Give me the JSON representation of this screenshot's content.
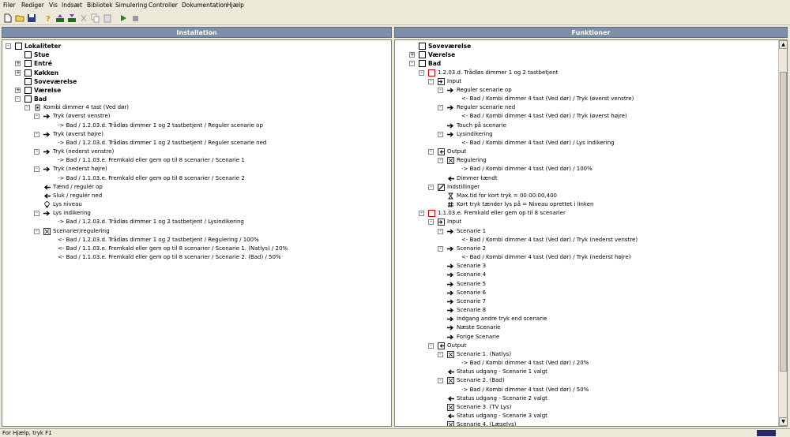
{
  "menu": [
    "Filer",
    "Rediger",
    "Vis",
    "Indsæt",
    "Bibliotek",
    "Simulering",
    "Controller",
    "Dokumentation",
    "Hjælp"
  ],
  "toolbar": {
    "icons": [
      "new-file-icon",
      "open-folder-icon",
      "save-icon",
      "help-icon",
      "upload-icon",
      "download-icon",
      "cut-icon",
      "copy-icon",
      "paste-icon",
      "play-icon",
      "stop-icon"
    ]
  },
  "installation": {
    "title": "Installation",
    "rows": [
      {
        "indent": 0,
        "expander": "-",
        "icon": "box",
        "text": "Lokaliteter",
        "bold": true
      },
      {
        "indent": 1,
        "expander": "",
        "icon": "box",
        "text": "Stue",
        "bold": true
      },
      {
        "indent": 1,
        "expander": "+",
        "icon": "box",
        "text": "Entré",
        "bold": true
      },
      {
        "indent": 1,
        "expander": "+",
        "icon": "box",
        "text": "Køkken",
        "bold": true
      },
      {
        "indent": 1,
        "expander": "",
        "icon": "box",
        "text": "Soveværelse",
        "bold": true
      },
      {
        "indent": 1,
        "expander": "+",
        "icon": "box",
        "text": "Værelse",
        "bold": true
      },
      {
        "indent": 1,
        "expander": "-",
        "icon": "box",
        "text": "Bad",
        "bold": true
      },
      {
        "indent": 2,
        "expander": "-",
        "icon": "device",
        "text": "Kombi dimmer 4 tast (Ved dør)"
      },
      {
        "indent": 3,
        "expander": "-",
        "icon": "arrow-right",
        "text": "Tryk (øverst venstre)"
      },
      {
        "indent": 4,
        "expander": "",
        "icon": "link",
        "text": "-> Bad / 1.2.03.d. Trådløs dimmer 1 og 2 tastbetjent / Reguler scenarie op"
      },
      {
        "indent": 3,
        "expander": "-",
        "icon": "arrow-right",
        "text": "Tryk (øverst højre)"
      },
      {
        "indent": 4,
        "expander": "",
        "icon": "link",
        "text": "-> Bad / 1.2.03.d. Trådløs dimmer 1 og 2 tastbetjent / Reguler scenarie ned"
      },
      {
        "indent": 3,
        "expander": "-",
        "icon": "arrow-right",
        "text": "Tryk (nederst venstre)"
      },
      {
        "indent": 4,
        "expander": "",
        "icon": "link",
        "text": "-> Bad / 1.1.03.e. Fremkald eller gem op til 8 scenarier / Scenarie 1"
      },
      {
        "indent": 3,
        "expander": "-",
        "icon": "arrow-right",
        "text": "Tryk (nederst højre)"
      },
      {
        "indent": 4,
        "expander": "",
        "icon": "link",
        "text": "-> Bad / 1.1.03.e. Fremkald eller gem op til 8 scenarier / Scenarie 2"
      },
      {
        "indent": 3,
        "expander": "",
        "icon": "arrow-left",
        "text": "Tænd / regulér op"
      },
      {
        "indent": 3,
        "expander": "",
        "icon": "arrow-left",
        "text": "Sluk / regulér ned"
      },
      {
        "indent": 3,
        "expander": "",
        "icon": "bulb",
        "text": "Lys niveau"
      },
      {
        "indent": 3,
        "expander": "-",
        "icon": "arrow-right",
        "text": "Lys indikering"
      },
      {
        "indent": 4,
        "expander": "",
        "icon": "link",
        "text": "-> Bad / 1.2.03.d. Trådløs dimmer 1 og 2 tastbetjent / Lysindikering"
      },
      {
        "indent": 3,
        "expander": "-",
        "icon": "scene",
        "text": "Scenarier/regulering"
      },
      {
        "indent": 4,
        "expander": "",
        "icon": "link",
        "text": "<- Bad / 1.2.03.d. Trådløs dimmer 1 og 2 tastbetjent / Regulering / 100%"
      },
      {
        "indent": 4,
        "expander": "",
        "icon": "link",
        "text": "<- Bad / 1.1.03.e. Fremkald eller gem op til 8 scenarier / Scenarie 1. (Natlys) / 20%"
      },
      {
        "indent": 4,
        "expander": "",
        "icon": "link",
        "text": "<- Bad / 1.1.03.e. Fremkald eller gem op til 8 scenarier / Scenarie 2. (Bad) / 50%"
      }
    ]
  },
  "funktioner": {
    "title": "Funktioner",
    "rows": [
      {
        "indent": 0,
        "expander": "",
        "icon": "box",
        "text": "Soveværelse",
        "bold": true
      },
      {
        "indent": 0,
        "expander": "+",
        "icon": "box",
        "text": "Værelse",
        "bold": true
      },
      {
        "indent": 0,
        "expander": "-",
        "icon": "box",
        "text": "Bad",
        "bold": true
      },
      {
        "indent": 1,
        "expander": "-",
        "icon": "redbox",
        "text": "1.2.03.d. Trådløs dimmer 1 og 2 tastbetjent"
      },
      {
        "indent": 2,
        "expander": "-",
        "icon": "input",
        "text": "Input"
      },
      {
        "indent": 3,
        "expander": "-",
        "icon": "arrow-right",
        "text": "Reguler scenarie op"
      },
      {
        "indent": 4,
        "expander": "",
        "icon": "link",
        "text": "<- Bad / Kombi dimmer 4 tast (Ved dør)  / Tryk (øverst venstre)"
      },
      {
        "indent": 3,
        "expander": "-",
        "icon": "arrow-right",
        "text": "Reguler scenarie ned"
      },
      {
        "indent": 4,
        "expander": "",
        "icon": "link",
        "text": "<- Bad / Kombi dimmer 4 tast (Ved dør)  / Tryk (øverst højre)"
      },
      {
        "indent": 3,
        "expander": "",
        "icon": "arrow-right",
        "text": "Touch på scenarie"
      },
      {
        "indent": 3,
        "expander": "-",
        "icon": "arrow-right",
        "text": "Lysindikering"
      },
      {
        "indent": 4,
        "expander": "",
        "icon": "link",
        "text": "<- Bad / Kombi dimmer 4 tast (Ved dør)  / Lys indikering"
      },
      {
        "indent": 2,
        "expander": "-",
        "icon": "output",
        "text": "Output"
      },
      {
        "indent": 3,
        "expander": "-",
        "icon": "scene",
        "text": "Regulering"
      },
      {
        "indent": 4,
        "expander": "",
        "icon": "link",
        "text": "-> Bad / Kombi dimmer 4 tast (Ved dør)  / 100%"
      },
      {
        "indent": 3,
        "expander": "",
        "icon": "arrow-left",
        "text": "Dimmer tændt"
      },
      {
        "indent": 2,
        "expander": "-",
        "icon": "settings",
        "text": "Indstillinger"
      },
      {
        "indent": 3,
        "expander": "",
        "icon": "timer",
        "text": "Max.tid for kort tryk = 00:00:00,400"
      },
      {
        "indent": 3,
        "expander": "",
        "icon": "hash",
        "text": "Kort tryk tænder lys på = Niveau oprettet i linken"
      },
      {
        "indent": 1,
        "expander": "-",
        "icon": "redbox",
        "text": "1.1.03.e. Fremkald eller gem op til 8 scenarier"
      },
      {
        "indent": 2,
        "expander": "-",
        "icon": "input",
        "text": "Input"
      },
      {
        "indent": 3,
        "expander": "-",
        "icon": "arrow-right",
        "text": "Scenarie 1"
      },
      {
        "indent": 4,
        "expander": "",
        "icon": "link",
        "text": "<- Bad / Kombi dimmer 4 tast (Ved dør)  / Tryk (nederst venstre)"
      },
      {
        "indent": 3,
        "expander": "-",
        "icon": "arrow-right",
        "text": "Scenarie 2"
      },
      {
        "indent": 4,
        "expander": "",
        "icon": "link",
        "text": "<- Bad / Kombi dimmer 4 tast (Ved dør)  / Tryk (nederst højre)"
      },
      {
        "indent": 3,
        "expander": "",
        "icon": "arrow-right",
        "text": "Scenarie 3"
      },
      {
        "indent": 3,
        "expander": "",
        "icon": "arrow-right",
        "text": "Scenarie 4"
      },
      {
        "indent": 3,
        "expander": "",
        "icon": "arrow-right",
        "text": "Scenarie 5"
      },
      {
        "indent": 3,
        "expander": "",
        "icon": "arrow-right",
        "text": "Scenarie 6"
      },
      {
        "indent": 3,
        "expander": "",
        "icon": "arrow-right",
        "text": "Scenarie 7"
      },
      {
        "indent": 3,
        "expander": "",
        "icon": "arrow-right",
        "text": "Scenarie 8"
      },
      {
        "indent": 3,
        "expander": "",
        "icon": "arrow-right",
        "text": "Indgang andre tryk end scenarie"
      },
      {
        "indent": 3,
        "expander": "",
        "icon": "arrow-right",
        "text": "Næste Scenarie"
      },
      {
        "indent": 3,
        "expander": "",
        "icon": "arrow-right",
        "text": "Forige Scenarie"
      },
      {
        "indent": 2,
        "expander": "-",
        "icon": "output",
        "text": "Output"
      },
      {
        "indent": 3,
        "expander": "-",
        "icon": "scene",
        "text": "Scenarie 1. (Natlys)"
      },
      {
        "indent": 4,
        "expander": "",
        "icon": "link",
        "text": "-> Bad / Kombi dimmer 4 tast (Ved dør)  / 20%"
      },
      {
        "indent": 3,
        "expander": "",
        "icon": "arrow-left",
        "text": "Status udgang - Scenarie 1 valgt"
      },
      {
        "indent": 3,
        "expander": "-",
        "icon": "scene",
        "text": "Scenarie 2. (Bad)"
      },
      {
        "indent": 4,
        "expander": "",
        "icon": "link",
        "text": "-> Bad / Kombi dimmer 4 tast (Ved dør)  / 50%"
      },
      {
        "indent": 3,
        "expander": "",
        "icon": "arrow-left",
        "text": "Status udgang - Scenarie 2 valgt"
      },
      {
        "indent": 3,
        "expander": "",
        "icon": "scene",
        "text": "Scenarie 3. (TV Lys)"
      },
      {
        "indent": 3,
        "expander": "",
        "icon": "arrow-left",
        "text": "Status udgang - Scenarie 3 valgt"
      },
      {
        "indent": 3,
        "expander": "",
        "icon": "scene",
        "text": "Scenarie 4. (Læselys)"
      }
    ]
  },
  "status": {
    "text": "For Hjælp, tryk F1"
  }
}
